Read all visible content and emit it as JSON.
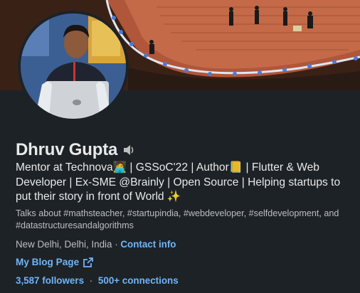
{
  "profile": {
    "name": "Dhruv Gupta",
    "headline": "Mentor at Technova🧑‍💻 | GSSoC'22 | Author📒 | Flutter & Web Developer | Ex-SME @Brainly | Open Source | Helping startups to put their story in front of World ✨",
    "topics": "Talks about #mathsteacher, #startupindia, #webdeveloper, #selfdevelopment, and #datastructuresandalgorithms",
    "location": "New Delhi, Delhi, India",
    "separator": " · ",
    "contact_label": "Contact info",
    "blog_label": "My Blog Page",
    "followers_label": "3,587 followers",
    "connections_label": "500+ connections"
  },
  "icons": {
    "pronunciation": "speaker-icon",
    "blog_link": "external-link-icon"
  },
  "colors": {
    "background": "#1d2226",
    "link": "#70b5f9",
    "text_primary": "#ffffffe6",
    "text_secondary": "#ffffffb3"
  }
}
